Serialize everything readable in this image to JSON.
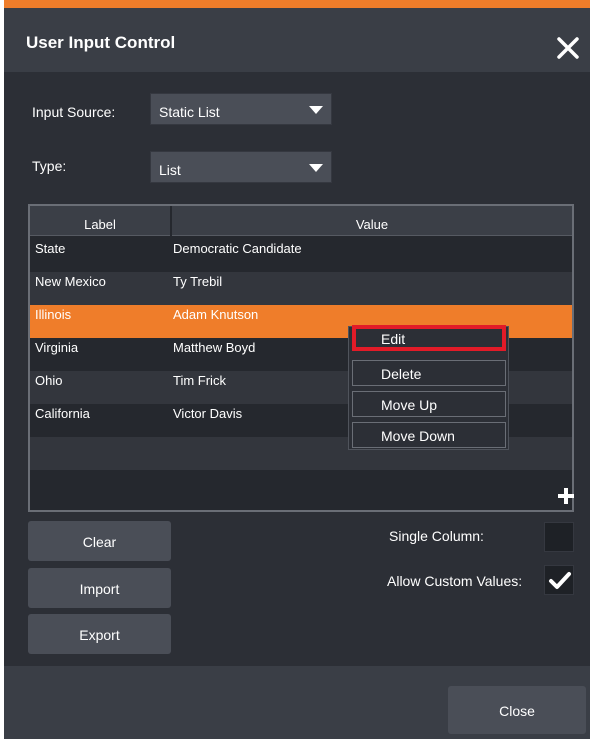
{
  "dialog": {
    "title": "User Input Control",
    "close_icon": "close-icon"
  },
  "form": {
    "input_source_label": "Input Source:",
    "input_source_value": "Static List",
    "type_label": "Type:",
    "type_value": "List"
  },
  "table": {
    "columns": [
      "Label",
      "Value"
    ],
    "rows": [
      {
        "label": "State",
        "value": "Democratic Candidate"
      },
      {
        "label": "New Mexico",
        "value": "Ty Trebil"
      },
      {
        "label": "Illinois",
        "value": "Adam Knutson"
      },
      {
        "label": "Virginia",
        "value": "Matthew Boyd"
      },
      {
        "label": "Ohio",
        "value": "Tim Frick"
      },
      {
        "label": "California",
        "value": "Victor Davis"
      }
    ],
    "selected_row": 2,
    "add_icon": "plus-icon"
  },
  "context_menu": {
    "items": [
      "Edit",
      "Delete",
      "Move Up",
      "Move Down"
    ],
    "highlighted": "Edit"
  },
  "buttons": {
    "clear": "Clear",
    "import": "Import",
    "export": "Export",
    "close": "Close"
  },
  "options": {
    "single_column_label": "Single Column:",
    "single_column_checked": false,
    "allow_custom_label": "Allow Custom Values:",
    "allow_custom_checked": true
  },
  "colors": {
    "accent": "#ef7d2a",
    "highlight_border": "#e21b28",
    "background": "#2c2f36"
  }
}
